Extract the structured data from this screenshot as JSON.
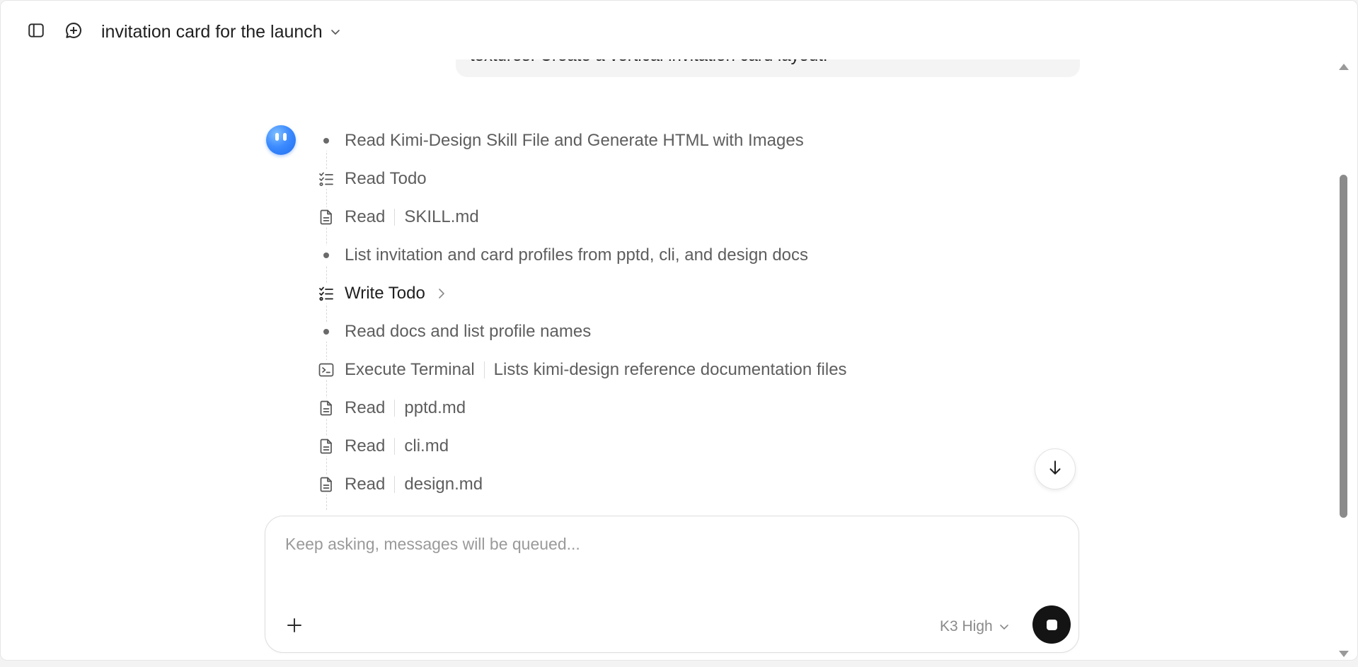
{
  "header": {
    "title": "invitation card for the launch"
  },
  "user_message": {
    "visible_text": "textures. Create a vertical invitation card layout."
  },
  "timeline": [
    {
      "icon": "bullet-dot",
      "label": "Read Kimi-Design Skill File and Generate HTML with Images",
      "detail": null
    },
    {
      "icon": "checklist-icon",
      "label": "Read Todo",
      "detail": null
    },
    {
      "icon": "file-icon",
      "label": "Read",
      "detail": "SKILL.md"
    },
    {
      "icon": "bullet-dot",
      "label": "List invitation and card profiles from pptd, cli, and design docs",
      "detail": null
    },
    {
      "icon": "checklist-icon",
      "label": "Write Todo",
      "detail": null,
      "expandable": true
    },
    {
      "icon": "bullet-dot",
      "label": "Read docs and list profile names",
      "detail": null
    },
    {
      "icon": "terminal-icon",
      "label": "Execute Terminal",
      "detail": "Lists kimi-design reference documentation files"
    },
    {
      "icon": "file-icon",
      "label": "Read",
      "detail": "pptd.md"
    },
    {
      "icon": "file-icon",
      "label": "Read",
      "detail": "cli.md"
    },
    {
      "icon": "file-icon",
      "label": "Read",
      "detail": "design.md"
    }
  ],
  "composer": {
    "placeholder": "Keep asking, messages will be queued...",
    "value": "",
    "model_label": "K3 High"
  },
  "colors": {
    "accent": "#3d8bff",
    "stop_button": "#141414",
    "text_primary": "#1f1f1f",
    "text_secondary": "#5e5e5e"
  }
}
